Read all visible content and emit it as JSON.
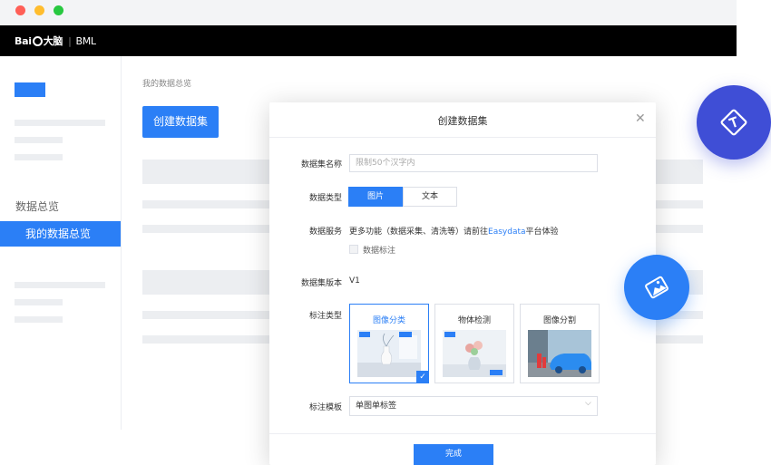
{
  "window": {
    "dot_colors": [
      "#ff5f57",
      "#ffbd2e",
      "#28c840"
    ]
  },
  "appbar": {
    "logo_text_left": "Bai",
    "logo_text_right": "大脑",
    "product": "BML"
  },
  "sidebar": {
    "section_label": "数据总览",
    "selected_item": "我的数据总览"
  },
  "main": {
    "breadcrumb": "我的数据总览",
    "create_button": "创建数据集"
  },
  "modal": {
    "title": "创建数据集",
    "close_icon": "close-icon",
    "fields": {
      "name_label": "数据集名称",
      "name_placeholder": "限制50个汉字内",
      "type_label": "数据类型",
      "type_options": [
        "图片",
        "文本"
      ],
      "type_selected": "图片",
      "service_label": "数据服务",
      "service_text_pre": "更多功能（数据采集、清洗等）请前往",
      "service_link": "Easydata",
      "service_text_post": "平台体验",
      "service_checkbox_label": "数据标注",
      "version_label": "数据集版本",
      "version_value": "V1",
      "annotation_type_label": "标注类型",
      "annotation_types": [
        "图像分类",
        "物体检测",
        "图像分割"
      ],
      "annotation_type_selected": "图像分类",
      "template_label": "标注模板",
      "template_value": "单图单标签"
    },
    "submit_button": "完成"
  },
  "floating_icons": [
    "text-annotation-icon",
    "image-annotation-icon"
  ],
  "colors": {
    "accent": "#2b7ff6",
    "indigo": "#3f4ed6",
    "appbar": "#000000"
  }
}
